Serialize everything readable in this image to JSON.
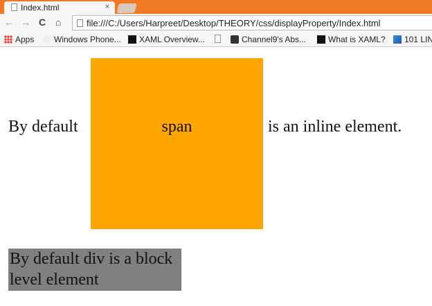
{
  "browser": {
    "tab_title": "Index.html",
    "close": "×",
    "url": "file:///C:/Users/Harpreet/Desktop/THEORY/css/displayProperty/Index.html",
    "nav": {
      "back": "←",
      "forward": "→",
      "reload": "C",
      "home": "⌂"
    },
    "bookmarks": [
      {
        "label": "Apps",
        "icon": "apps-grid-icon"
      },
      {
        "label": "Windows Phone...",
        "icon": "windows-phone-icon"
      },
      {
        "label": "XAML Overview...",
        "icon": "m-icon"
      },
      {
        "label": "",
        "icon": "page-icon"
      },
      {
        "label": "Channel9's Abs...",
        "icon": "channel9-icon"
      },
      {
        "label": "What is XAML?",
        "icon": "m-icon"
      },
      {
        "label": "101 LIN",
        "icon": "101-icon"
      }
    ]
  },
  "content": {
    "before": "By default",
    "span": "span",
    "after": "is an inline element.",
    "div": "By default div is a block level element"
  },
  "colors": {
    "tabbar": "#f07a24",
    "span_bg": "#ffa500",
    "div_bg": "#808080"
  }
}
